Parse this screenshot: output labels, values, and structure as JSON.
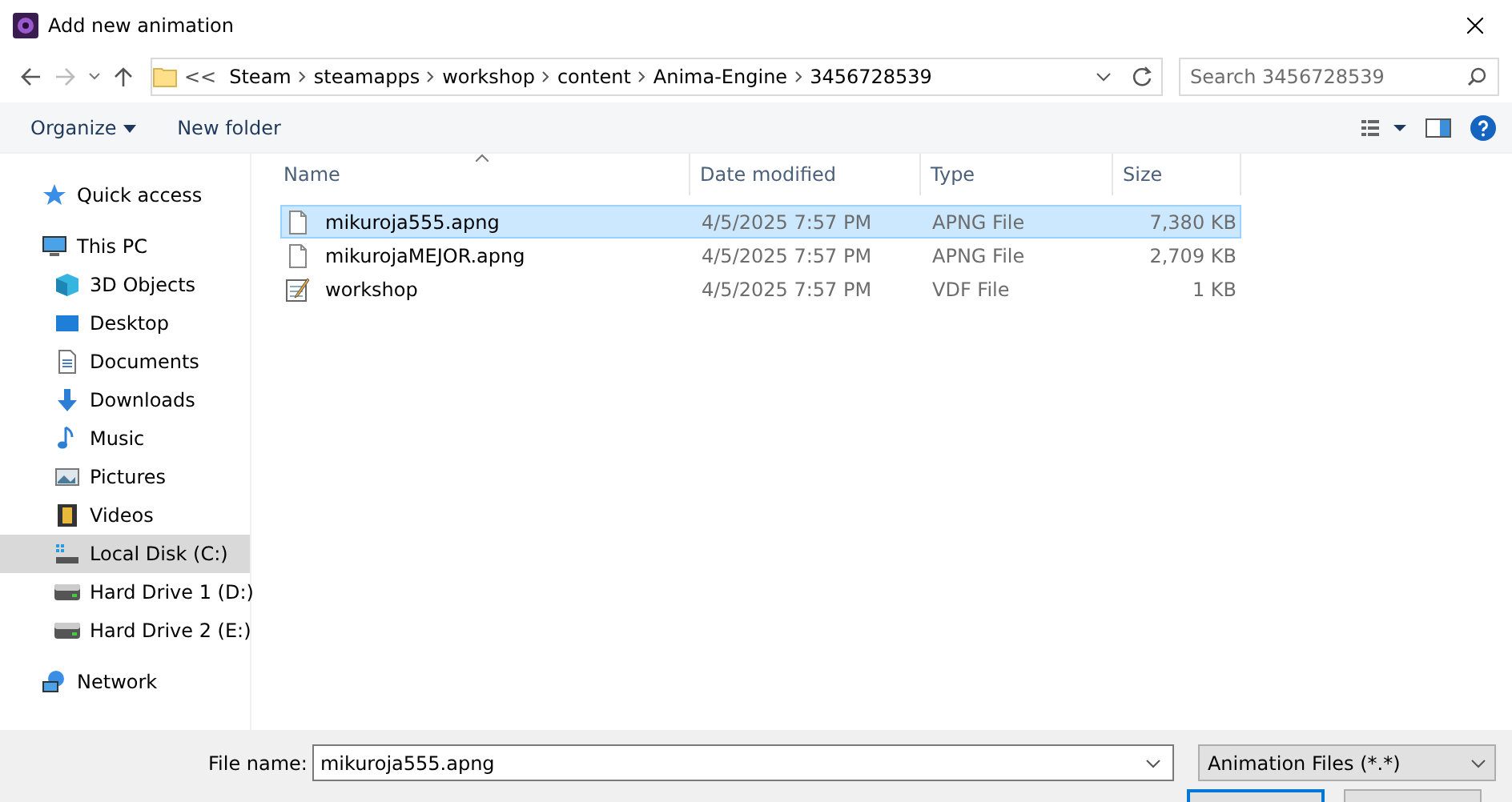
{
  "window": {
    "title": "Add new animation"
  },
  "address_bar": {
    "overflow": "<<",
    "crumbs": [
      "Steam",
      "steamapps",
      "workshop",
      "content",
      "Anima-Engine",
      "3456728539"
    ]
  },
  "search": {
    "placeholder": "Search 3456728539"
  },
  "toolbar": {
    "organize": "Organize",
    "new_folder": "New folder"
  },
  "sidebar": {
    "items": [
      {
        "label": "Quick access",
        "selected": false
      },
      {
        "label": "This PC",
        "selected": false,
        "children": [
          {
            "label": "3D Objects",
            "selected": false
          },
          {
            "label": "Desktop",
            "selected": false
          },
          {
            "label": "Documents",
            "selected": false
          },
          {
            "label": "Downloads",
            "selected": false
          },
          {
            "label": "Music",
            "selected": false
          },
          {
            "label": "Pictures",
            "selected": false
          },
          {
            "label": "Videos",
            "selected": false
          },
          {
            "label": "Local Disk (C:)",
            "selected": true
          },
          {
            "label": "Hard Drive 1 (D:)",
            "selected": false
          },
          {
            "label": "Hard Drive 2 (E:)",
            "selected": false
          }
        ]
      },
      {
        "label": "Network",
        "selected": false
      }
    ]
  },
  "table": {
    "columns": [
      "Name",
      "Date modified",
      "Type",
      "Size"
    ],
    "rows": [
      {
        "kind": "file",
        "name": "mikuroja555.apng",
        "date": "4/5/2025 7:57 PM",
        "type": "APNG File",
        "size": "7,380 KB",
        "selected": true
      },
      {
        "kind": "file",
        "name": "mikurojaMEJOR.apng",
        "date": "4/5/2025 7:57 PM",
        "type": "APNG File",
        "size": "2,709 KB",
        "selected": false
      },
      {
        "kind": "text",
        "name": "workshop",
        "date": "4/5/2025 7:57 PM",
        "type": "VDF File",
        "size": "1 KB",
        "selected": false
      }
    ]
  },
  "footer": {
    "file_name_label": "File name:",
    "file_name": "mikuroja555.apng",
    "filter": "Animation Files (*.*)"
  }
}
